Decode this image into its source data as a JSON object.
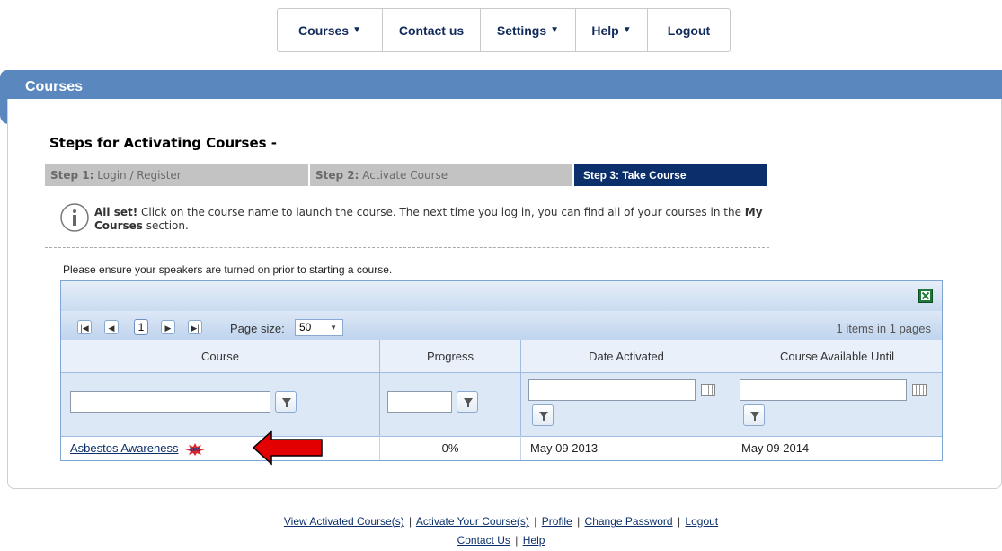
{
  "nav": {
    "courses": "Courses",
    "contact": "Contact us",
    "settings": "Settings",
    "help": "Help",
    "logout": "Logout",
    "arrow": "▼"
  },
  "section_title": "Courses",
  "steps_title": "Steps for Activating Courses  -",
  "steps": {
    "step1_label": "Step 1:",
    "step1_text": "Login / Register",
    "step2_label": "Step 2:",
    "step2_text": "Activate Course",
    "step3_label": "Step 3:",
    "step3_text": "Take Course"
  },
  "info": {
    "bold1": "All set!",
    "text1": " Click on the course name to launch the course.   The next time you log in, you can find all of your courses in the ",
    "bold2": "My Courses",
    "text2": " section."
  },
  "speakers_note": "Please ensure your speakers are turned on prior to starting a course.",
  "grid": {
    "page_number": "1",
    "page_size_label": "Page size:",
    "page_size_value": "50",
    "page_info": "1 items in 1 pages",
    "headers": [
      "Course",
      "Progress",
      "Date Activated",
      "Course Available Until"
    ],
    "rows": [
      {
        "course": "Asbestos Awareness",
        "progress": "0%",
        "activated": "May 09 2013",
        "available_until": "May 09 2014"
      }
    ]
  },
  "footer": {
    "view_activated": "View Activated Course(s)",
    "activate": "Activate Your Course(s)",
    "profile": "Profile",
    "change_password": "Change Password",
    "logout": "Logout",
    "contact": "Contact Us",
    "help": "Help",
    "sep": "|"
  },
  "colors": {
    "header_blue": "#5a87bd",
    "step_active": "#0b2f6b",
    "arrow_red": "#e30000"
  }
}
